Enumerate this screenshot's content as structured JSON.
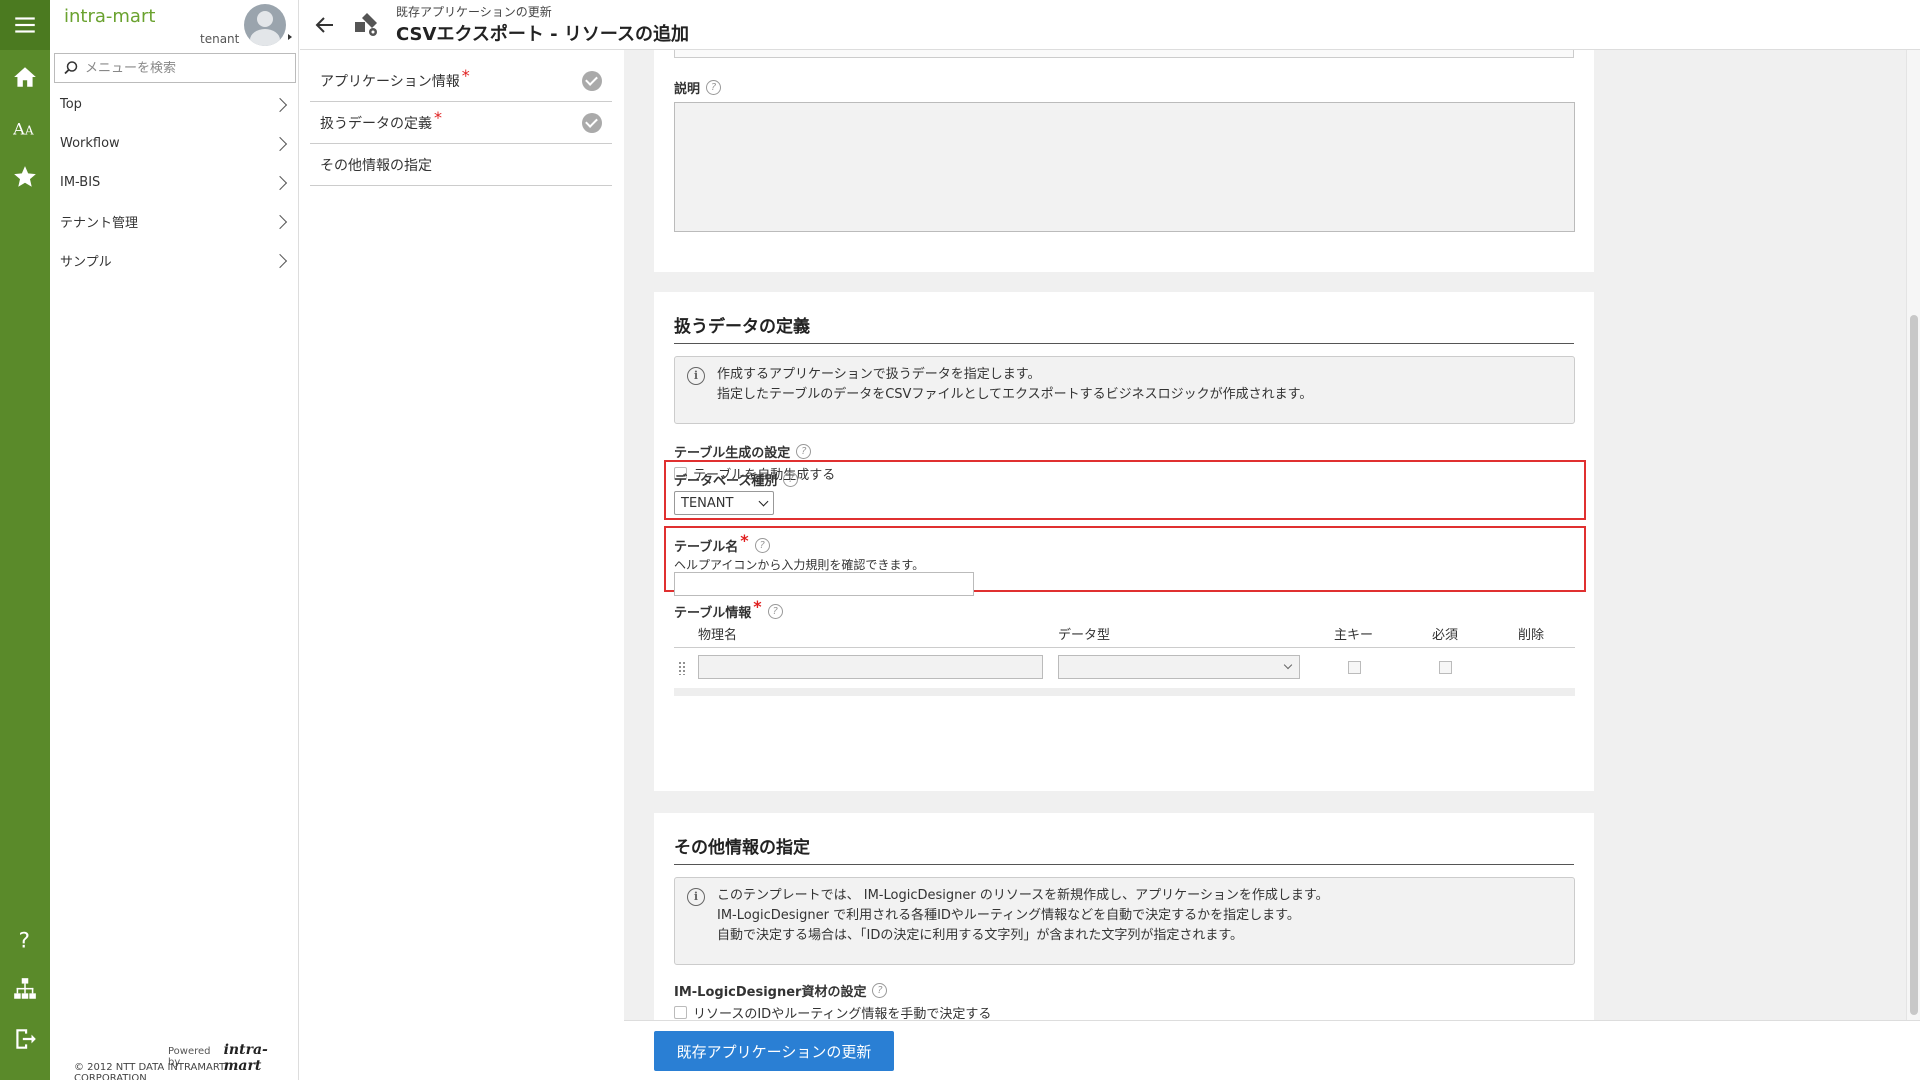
{
  "brand": "intra-mart",
  "user": {
    "tenant": "tenant"
  },
  "search": {
    "placeholder": "メニューを検索"
  },
  "nav": [
    {
      "label": "Top"
    },
    {
      "label": "Workflow"
    },
    {
      "label": "IM-BIS"
    },
    {
      "label": "テナント管理"
    },
    {
      "label": "サンプル"
    }
  ],
  "footer": {
    "powered": "Powered by",
    "logo": "intra-mart",
    "copyright": "© 2012 NTT DATA INTRAMART CORPORATION"
  },
  "header": {
    "subtitle": "既存アプリケーションの更新",
    "title": "CSVエクスポート - リソースの追加"
  },
  "steps": [
    {
      "label": "アプリケーション情報",
      "required": "*",
      "done": true
    },
    {
      "label": "扱うデータの定義",
      "required": "*",
      "done": true
    },
    {
      "label": "その他情報の指定",
      "required": "",
      "done": false
    }
  ],
  "panel1": {
    "description_label": "説明"
  },
  "panel2": {
    "title": "扱うデータの定義",
    "info_line1": "作成するアプリケーションで扱うデータを指定します。",
    "info_line2": "指定したテーブルのデータをCSVファイルとしてエクスポートするビジネスロジックが作成されます。",
    "table_gen_label": "テーブル生成の設定",
    "table_gen_checkbox": "テーブルを自動生成する",
    "db_type_label": "データベース種別",
    "db_type_value": "TENANT",
    "table_name_label": "テーブル名",
    "table_name_help": "ヘルプアイコンから入力規則を確認できます。",
    "table_info_label": "テーブル情報",
    "columns": {
      "physical": "物理名",
      "type": "データ型",
      "pk": "主キー",
      "required": "必須",
      "delete": "削除"
    }
  },
  "panel3": {
    "title": "その他情報の指定",
    "info_line1": "このテンプレートでは、 IM-LogicDesigner のリソースを新規作成し、アプリケーションを作成します。",
    "info_line2": "IM-LogicDesigner で利用される各種IDやルーティング情報などを自動で決定するかを指定します。",
    "info_line3": "自動で決定する場合は、「IDの決定に利用する文字列」が含まれた文字列が指定されます。",
    "ld_label": "IM-LogicDesigner資材の設定",
    "ld_checkbox": "リソースのIDやルーティング情報を手動で決定する"
  },
  "actions": {
    "submit": "既存アプリケーションの更新"
  },
  "help_glyph": "?",
  "info_glyph": "i",
  "icons": [
    "menu-icon",
    "home-icon",
    "font-size-icon",
    "star-icon",
    "help-icon",
    "sitemap-icon",
    "logout-icon",
    "search-icon",
    "back-arrow-icon",
    "app-builder-icon"
  ]
}
